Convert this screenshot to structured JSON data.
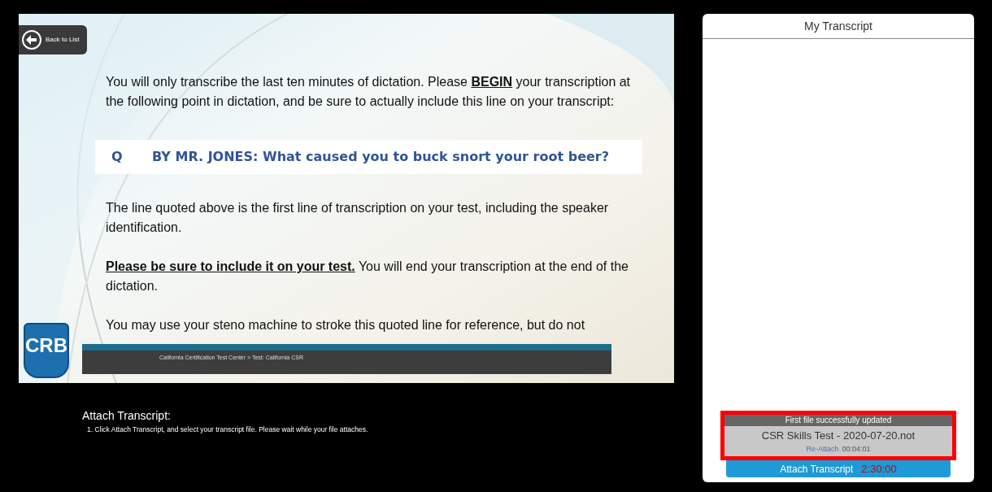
{
  "slide": {
    "back_button": "Back to List",
    "paragraphs": [
      [
        {
          "text": "You will only transcribe the last ten minutes of dictation. Please ",
          "emphasis": false
        },
        {
          "text": "BEGIN",
          "emphasis": true
        },
        {
          "text": " your transcription at the following point in dictation, and be sure to actually include this line on your transcript:",
          "emphasis": false
        }
      ],
      [
        {
          "text": "The line quoted above is the first line of transcription on your test, including the speaker identification.",
          "emphasis": false
        }
      ],
      [
        {
          "text": "Please be sure to include it on your test.",
          "emphasis": true
        },
        {
          "text": " You will end your transcription at the end of the dictation.",
          "emphasis": false
        }
      ],
      [
        {
          "text": "You may use your steno machine to stroke this quoted line for reference, but do not",
          "emphasis": false
        }
      ]
    ],
    "quote": {
      "speaker": "Q",
      "text": "BY MR. JONES: What caused you to buck snort your root beer?"
    },
    "logo": "CRB",
    "breadcrumb": "California Certification Test Center > Test: California CSR"
  },
  "instructions": {
    "title": "Attach Transcript:",
    "steps": [
      "1. Click Attach Transcript, and select your transcript file. Please wait while your file attaches."
    ]
  },
  "transcript_panel": {
    "title": "My Transcript",
    "notice": {
      "status": "First file successfully updated",
      "file_name": "CSR Skills Test - 2020-07-20.not",
      "reattach_link": "Re-Attach",
      "elapsed": "00:04:01",
      "highlighted": true
    },
    "attach_button": "Attach Transcript",
    "timer": "2:30:00"
  }
}
